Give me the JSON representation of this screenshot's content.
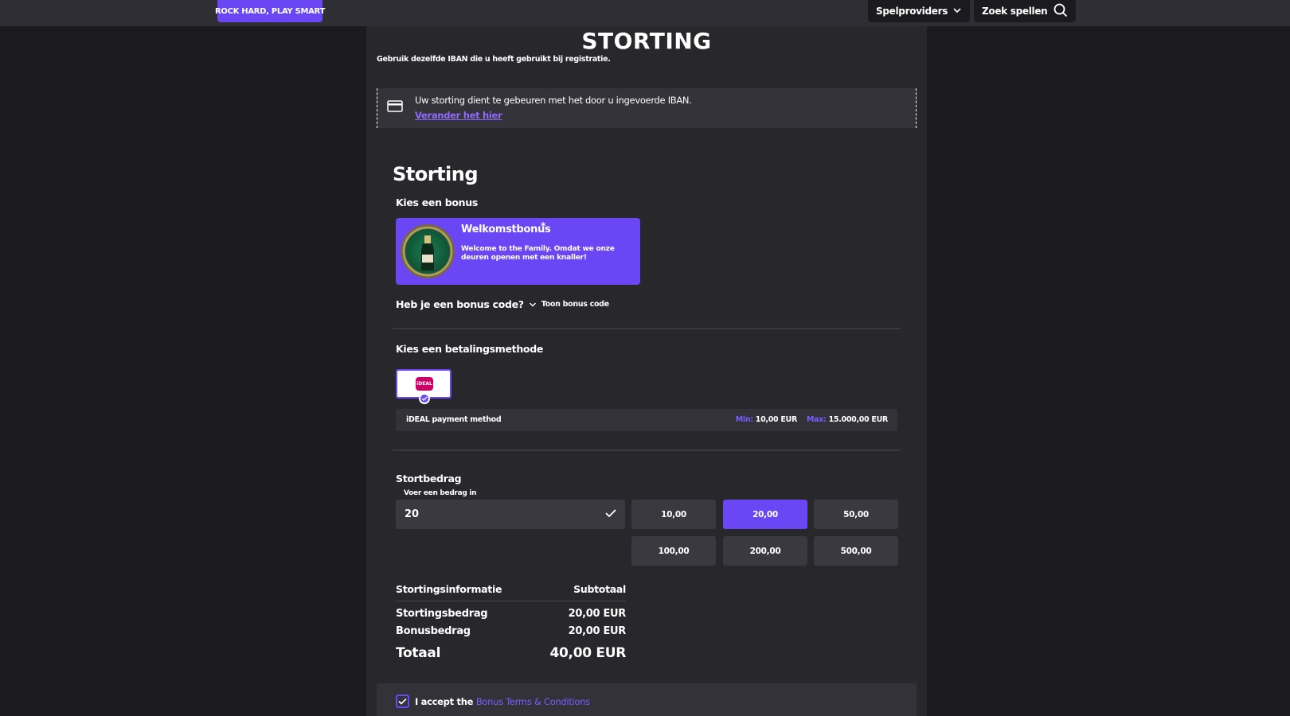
{
  "header": {
    "promo_label": "ROCK HARD, PLAY SMART",
    "providers_label": "Spelproviders",
    "search_label": "Zoek spellen"
  },
  "page": {
    "title": "STORTING",
    "subtitle": "Gebruik dezelfde IBAN die u heeft gebruikt bij registratie."
  },
  "notice": {
    "text": "Uw storting dient te gebeuren met het door u ingevoerde IBAN.",
    "link": "Verander het hier",
    "icon": "credit-card-icon"
  },
  "deposit": {
    "section_title": "Storting",
    "bonus_label": "Kies een bonus",
    "bonus": {
      "title": "Welkomstbonus",
      "star": "*",
      "description": "Welcome to the Family. Omdat we onze deuren openen met een knaller!"
    },
    "bonus_code_question": "Heb je een bonus code?",
    "bonus_code_toggle": "Toon bonus code",
    "payment_label": "Kies een betalingsmethode",
    "payment": {
      "logo_text": "iDEAL",
      "name": "iDEAL payment method",
      "min_label": "Min:",
      "min_value": "10,00 EUR",
      "max_label": "Max:",
      "max_value": "15.000,00 EUR"
    },
    "amount_label": "Stortbedrag",
    "amount_hint": "Voer een bedrag in",
    "amount_value": "20",
    "amount_options": [
      "10,00",
      "20,00",
      "50,00",
      "100,00",
      "200,00",
      "500,00"
    ],
    "selected_amount": "20,00"
  },
  "summary": {
    "header_left": "Stortingsinformatie",
    "header_right": "Subtotaal",
    "rows": [
      {
        "label": "Stortingsbedrag",
        "value": "20,00 EUR"
      },
      {
        "label": "Bonusbedrag",
        "value": "20,00 EUR"
      }
    ],
    "total_label": "Totaal",
    "total_value": "40,00 EUR"
  },
  "accept": {
    "prefix": "I accept the",
    "link": "Bonus Terms & Conditions",
    "checked": true
  },
  "colors": {
    "accent": "#6b46f5",
    "background": "#1b1a1e",
    "panel": "#28272c"
  }
}
